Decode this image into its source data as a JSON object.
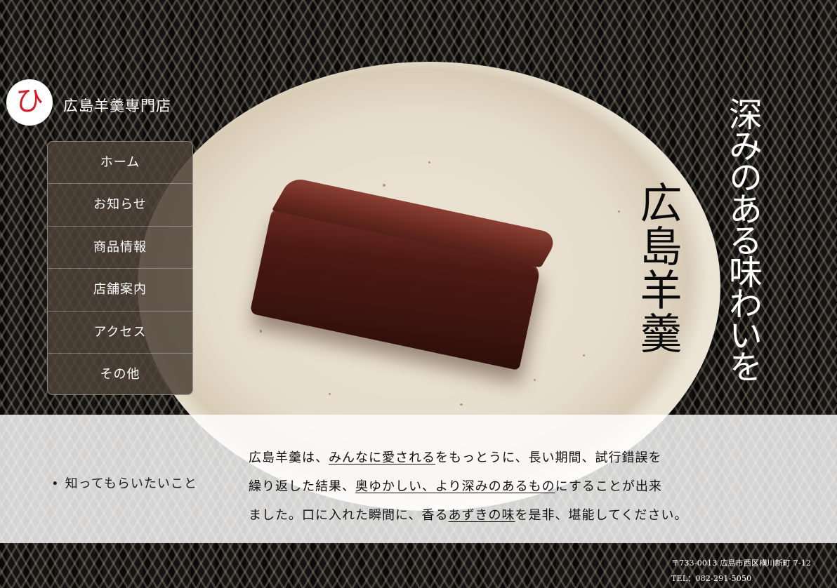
{
  "brand": {
    "logo_char": "ひ",
    "shop_name": "広島羊羹専門店",
    "accent_color": "#d0202a"
  },
  "nav": {
    "items": [
      {
        "label": "ホーム"
      },
      {
        "label": "お知らせ"
      },
      {
        "label": "商品情報"
      },
      {
        "label": "店舗案内"
      },
      {
        "label": "アクセス"
      },
      {
        "label": "その他"
      }
    ]
  },
  "hero": {
    "title": "広島羊羹",
    "tagline": "深みのある味わいを"
  },
  "info": {
    "bullet_label": "知ってもらいたいこと",
    "description": {
      "line1_a": "広島羊羹は、",
      "line1_u": "みんなに愛される",
      "line1_b": "をもっとうに、長い期間、試行錯誤を",
      "line2_a": "繰り返した結果、",
      "line2_u": "奥ゆかしい、より深みのあるもの",
      "line2_b": "にすることが出来",
      "line3_a": "ました。口に入れた瞬間に、香る",
      "line3_u": "あずきの味",
      "line3_b": "を是非、堪能してください。"
    }
  },
  "footer": {
    "address": "〒733-0013 広島市西区横川新町 7-12",
    "tel": "TEL：082-291-5050"
  }
}
